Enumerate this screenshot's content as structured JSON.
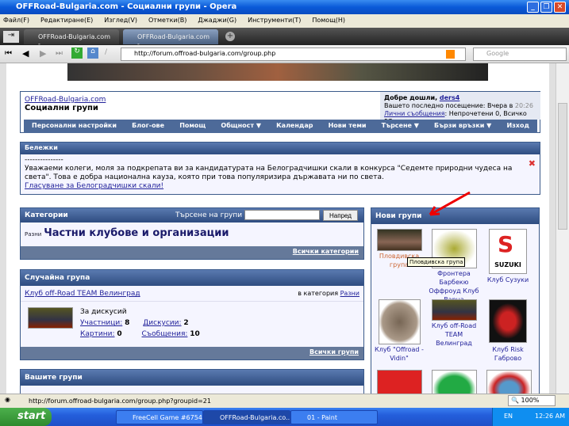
{
  "window": {
    "title": "OFFRoad-Bulgaria.com - Социални групи - Opera"
  },
  "menu": [
    "Файл(F)",
    "Редактиране(E)",
    "Изглед(V)",
    "Отметки(B)",
    "Джаджи(G)",
    "Инструменти(T)",
    "Помощ(H)"
  ],
  "tabs": [
    {
      "label": "OFFRoad-Bulgaria.com -..."
    },
    {
      "label": "OFFRoad-Bulgaria.com -..."
    }
  ],
  "address": {
    "url": "http://forum.offroad-bulgaria.com/group.php",
    "search_placeholder": "Google"
  },
  "header": {
    "site_link": "OFFRoad-Bulgaria.com",
    "page_title": "Социални групи",
    "welcome": "Добре дошли, ",
    "username": "ders4",
    "last_visit": "Вашето последно посещение: Вчера в ",
    "last_visit_time": "20:26",
    "pm_link": "Лични съобщения",
    "pm_status": ": Непрочетени 0, Всичко 57."
  },
  "nav": [
    "Персонални настройки",
    "Блог-ове",
    "Помощ",
    "Общност ▼",
    "Календар",
    "Нови теми",
    "Търсене ▼",
    "Бързи връзки ▼",
    "Изход"
  ],
  "notices": {
    "title": "Бележки",
    "dashes": "---------------",
    "text": "Уважаеми колеги, моля за подкрепата ви за кандидатурата на Белоградчишки скали в конкурса \"Седемте природни чудеса на света\". Това е добра национална кауза, която при това популяризира държавата ни по света.",
    "link": "Гласуване за Белоградчишки скали!"
  },
  "categories": {
    "title": "Категории",
    "search_label": "Търсене на групи",
    "search_value": "",
    "go_button": "Напред",
    "small": "Разни",
    "big": "Частни клубове и организации",
    "footer_link": "Всички категории"
  },
  "random_group": {
    "title": "Случайна група",
    "name": "Клуб off-Road TEAM Велинград",
    "in_category": "в категория ",
    "category": "Разни",
    "desc": "За дискусий",
    "members_label": "Участници:",
    "members": "8",
    "discussions_label": "Дискусии:",
    "discussions": "2",
    "pictures_label": "Картини:",
    "pictures": "0",
    "messages_label": "Съобщения:",
    "messages": "10",
    "footer_link": "Всички групи"
  },
  "your_groups": {
    "title": "Вашите групи"
  },
  "new_groups": {
    "title": "Нови групи",
    "tooltip": "Пловдивска група",
    "items": [
      "Пловдивска група",
      "Фронтера Барбекю Оффроуд Клуб Варна",
      "Клуб Сузуки",
      "Клуб \"Offroad - Vidin\"",
      "Клуб off-Road TEAM Велинград",
      "Клуб Risk Габрово"
    ]
  },
  "status": {
    "url": "http://forum.offroad-bulgaria.com/group.php?groupid=21",
    "zoom": "100%"
  },
  "taskbar": {
    "start": "start",
    "items": [
      "FreeCell Game #6754",
      "OFFRoad-Bulgaria.co...",
      "01 - Paint"
    ],
    "lang": "EN",
    "time": "12:26 AM"
  }
}
